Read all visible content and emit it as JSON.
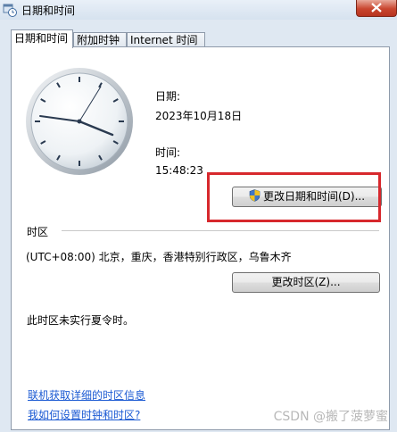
{
  "window": {
    "title": "日期和时间"
  },
  "tabs": [
    {
      "label": "日期和时间",
      "active": true
    },
    {
      "label": "附加时钟",
      "active": false
    },
    {
      "label": "Internet 时间",
      "active": false
    }
  ],
  "datetime": {
    "date_label": "日期:",
    "date_value": "2023年10月18日",
    "time_label": "时间:",
    "time_value": "15:48:23",
    "change_button": "更改日期和时间(D)..."
  },
  "timezone": {
    "section_label": "时区",
    "value": "(UTC+08:00) 北京，重庆，香港特别行政区，乌鲁木齐",
    "change_button": "更改时区(Z)...",
    "dst_note": "此时区未实行夏令时。"
  },
  "links": {
    "online_info": "联机获取详细的时区信息",
    "how_to": "我如何设置时钟和时区?"
  },
  "watermark": "CSDN @搬了菠萝蜜",
  "colors": {
    "highlight": "#d7282d",
    "link": "#1b5ad3",
    "close_button": "#c9462f"
  }
}
